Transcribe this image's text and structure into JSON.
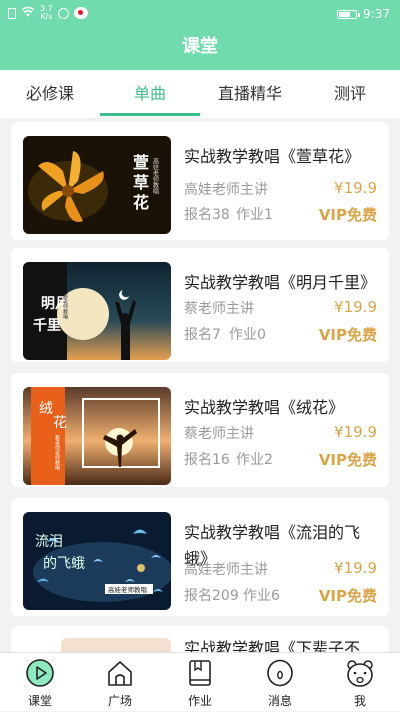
{
  "status_bar": {
    "network_speed": "3.7\nK/s",
    "time": "9:37",
    "battery_level": 0.7
  },
  "header": {
    "title": "课堂"
  },
  "tabs": [
    {
      "label": "必修课",
      "active": false
    },
    {
      "label": "单曲",
      "active": true
    },
    {
      "label": "直播精华",
      "active": false
    },
    {
      "label": "测评",
      "active": false
    }
  ],
  "courses": [
    {
      "title": "实战教学教唱《萱草花》",
      "teacher": "高娃老师主讲",
      "enroll": "报名38",
      "homework": "作业1",
      "price": "¥19.9",
      "vip": "VIP免费",
      "thumb_text": "萱草花",
      "thumb_sub": "高娃老师教唱"
    },
    {
      "title": "实战教学教唱《明月千里》",
      "teacher": "蔡老师主讲",
      "enroll": "报名7",
      "homework": "作业0",
      "price": "¥19.9",
      "vip": "VIP免费",
      "thumb_text": "明月千里",
      "thumb_sub": "蔡老师教唱"
    },
    {
      "title": "实战教学教唱《绒花》",
      "teacher": "蔡老师主讲",
      "enroll": "报名16",
      "homework": "作业2",
      "price": "¥19.9",
      "vip": "VIP免费",
      "thumb_text": "绒花",
      "thumb_sub": "蔡老师老师教唱"
    },
    {
      "title": "实战教学教唱《流泪的飞蛾》",
      "teacher": "高娃老师主讲",
      "enroll": "报名209",
      "homework": "作业6",
      "price": "¥19.9",
      "vip": "VIP免费",
      "thumb_text": "流泪的飞蛾",
      "thumb_sub": "高娃老师教唱"
    },
    {
      "title": "实战教学教唱《下辈子不"
    }
  ],
  "bottom_nav": [
    {
      "label": "课堂",
      "icon": "play-circle-icon",
      "active": true
    },
    {
      "label": "广场",
      "icon": "home-icon",
      "active": false
    },
    {
      "label": "作业",
      "icon": "book-icon",
      "active": false
    },
    {
      "label": "消息",
      "icon": "message-icon",
      "active": false
    },
    {
      "label": "我",
      "icon": "bear-face-icon",
      "active": false
    }
  ],
  "colors": {
    "header": "#70dcae",
    "accent": "#3fbf8a",
    "price": "#d9a54a",
    "background": "#f2f2f2"
  }
}
